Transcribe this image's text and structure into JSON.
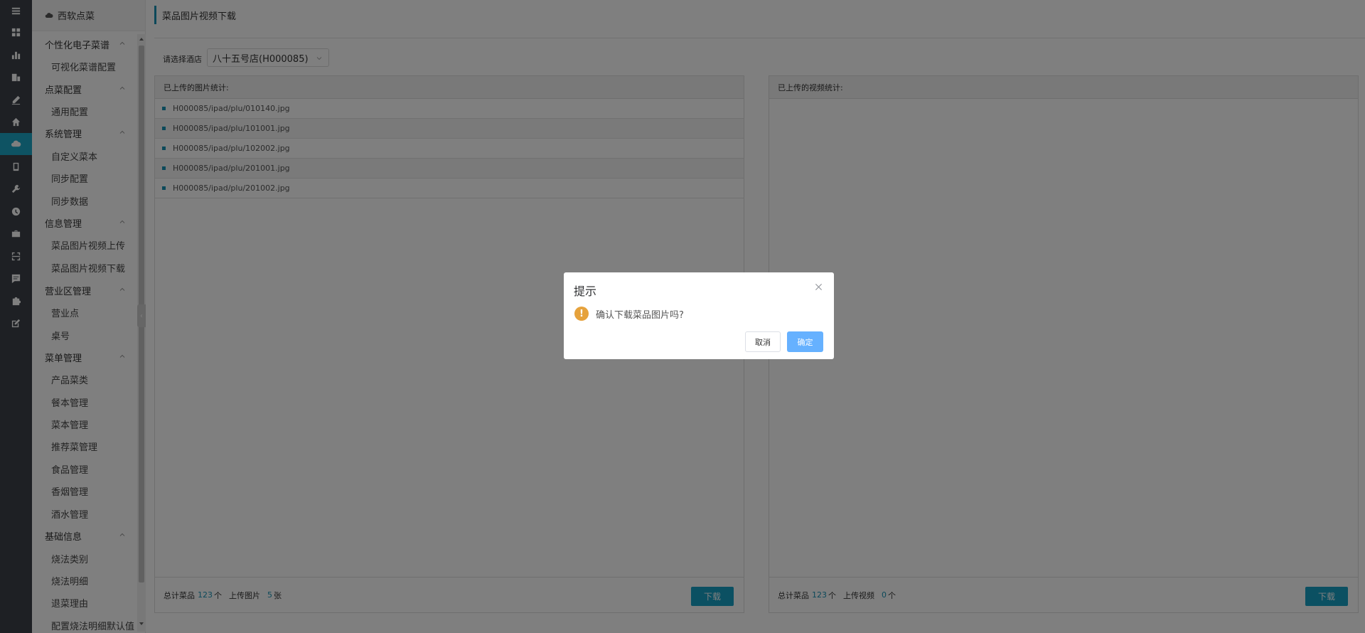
{
  "rail": {
    "icons": [
      "menu-icon",
      "dashboard-icon",
      "bar-chart-icon",
      "building-icon",
      "pen-icon",
      "home-icon",
      "cloud-icon",
      "tablet-icon",
      "wrench-icon",
      "clock-icon",
      "briefcase-icon",
      "scan-icon",
      "message-icon",
      "puzzle-icon",
      "edit-icon"
    ],
    "active": "cloud-icon"
  },
  "sidebar": {
    "header": "西软点菜",
    "groups": [
      {
        "label": "个性化电子菜谱",
        "items": [
          "可视化菜谱配置"
        ]
      },
      {
        "label": "点菜配置",
        "items": [
          "通用配置"
        ]
      },
      {
        "label": "系统管理",
        "items": [
          "自定义菜本",
          "同步配置",
          "同步数据"
        ]
      },
      {
        "label": "信息管理",
        "items": [
          "菜品图片视频上传",
          "菜品图片视频下载"
        ]
      },
      {
        "label": "营业区管理",
        "items": [
          "营业点",
          "桌号"
        ]
      },
      {
        "label": "菜单管理",
        "items": [
          "产品菜类",
          "餐本管理",
          "菜本管理",
          "推荐菜管理",
          "食品管理",
          "香烟管理",
          "酒水管理"
        ]
      },
      {
        "label": "基础信息",
        "items": [
          "烧法类别",
          "烧法明细",
          "退菜理由",
          "配置烧法明细默认值"
        ]
      }
    ]
  },
  "main": {
    "title": "菜品图片视频下载",
    "hotel_label": "请选择酒店",
    "hotel_value": "八十五号店(H000085)",
    "image_panel": {
      "header": "已上传的图片统计:",
      "files": [
        "H000085/ipad/plu/010140.jpg",
        "H000085/ipad/plu/101001.jpg",
        "H000085/ipad/plu/102002.jpg",
        "H000085/ipad/plu/201001.jpg",
        "H000085/ipad/plu/201002.jpg"
      ],
      "total_label": "总计菜品",
      "total_value": "123",
      "total_unit": "个",
      "upload_label": "上传图片",
      "upload_value": "5",
      "upload_unit": "张",
      "button": "下载"
    },
    "video_panel": {
      "header": "已上传的视频统计:",
      "total_label": "总计菜品",
      "total_value": "123",
      "total_unit": "个",
      "upload_label": "上传视频",
      "upload_value": "0",
      "upload_unit": "个",
      "button": "下载"
    }
  },
  "dialog": {
    "title": "提示",
    "message": "确认下载菜品图片吗?",
    "warn_glyph": "!",
    "cancel": "取消",
    "confirm": "确定"
  },
  "colors": {
    "accent": "#16a0c5",
    "rail_bg": "#3c4049",
    "warning": "#e6a23c",
    "confirm_button": "#66b1ff"
  }
}
